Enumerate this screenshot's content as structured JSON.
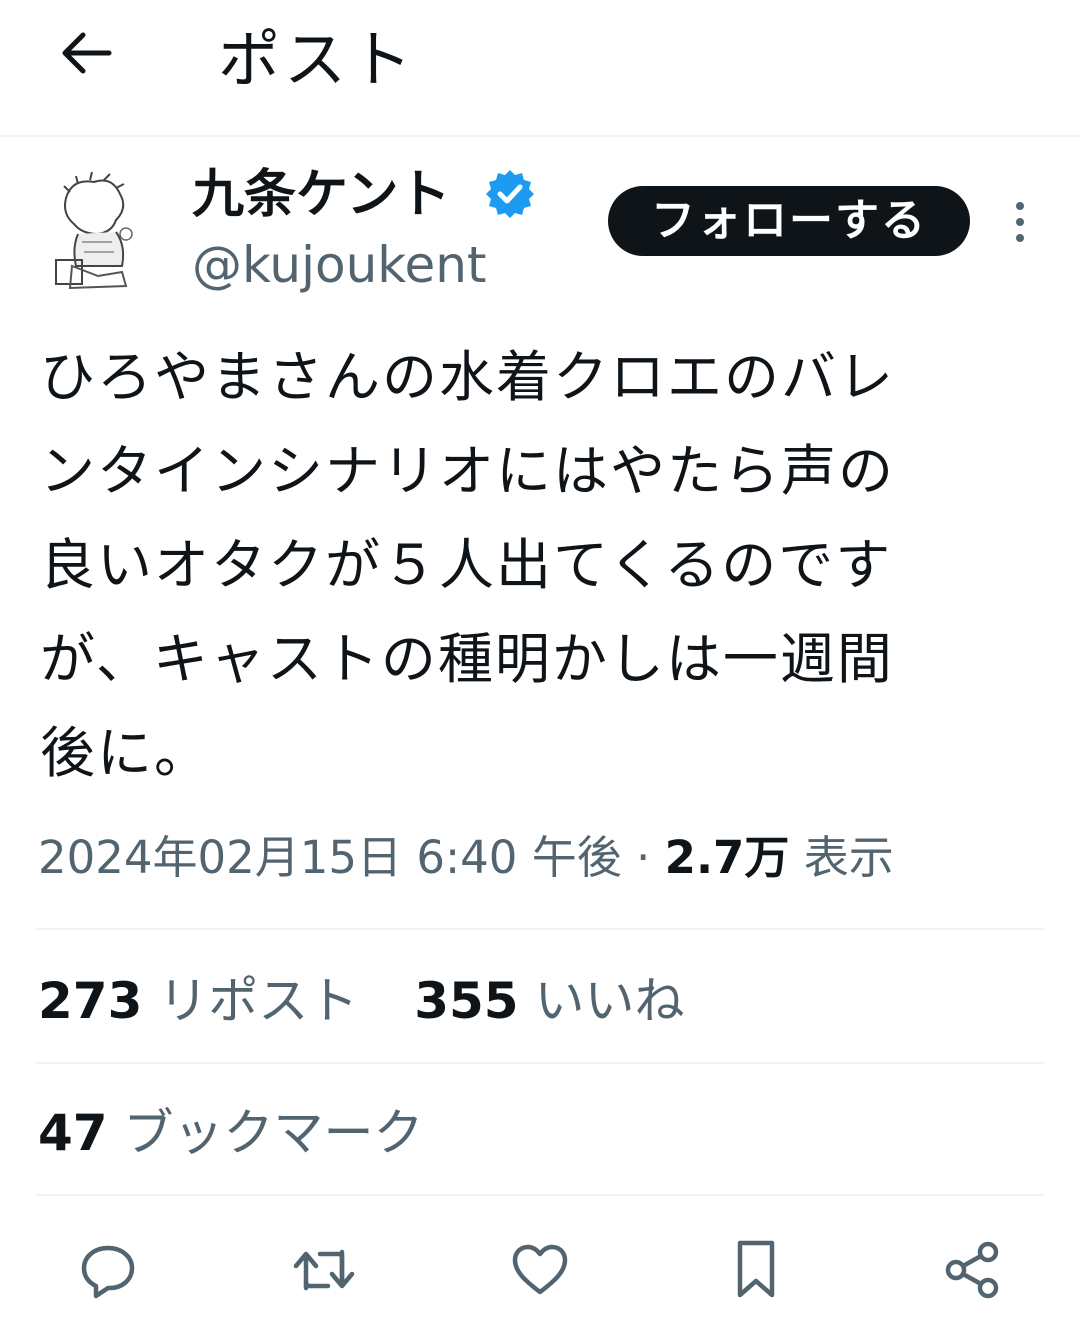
{
  "header": {
    "title": "ポスト",
    "back_icon": "arrow-left-icon"
  },
  "author": {
    "name": "九条ケント",
    "handle": "@kujoukent",
    "verified": true,
    "verified_color": "#1d9bf0"
  },
  "follow_label": "フォローする",
  "more_icon": "more-vertical-icon",
  "tweet": {
    "text": "ひろやまさんの水着クロエのバレ\nンタインシナリオにはやたら声の\n良いオタクが５人出てくるのです\nが、キャストの種明かしは一週間\n後に。"
  },
  "meta": {
    "timestamp": "2024年02月15日 6:40 午後",
    "separator": "·",
    "views_count": "2.7万",
    "views_label": "表示"
  },
  "stats": {
    "reposts_count": "273",
    "reposts_label": "リポスト",
    "likes_count": "355",
    "likes_label": "いいね",
    "bookmarks_count": "47",
    "bookmarks_label": "ブックマーク"
  },
  "actions": [
    "reply-icon",
    "repost-icon",
    "like-icon",
    "bookmark-icon",
    "share-icon"
  ],
  "colors": {
    "text": "#0f1419",
    "secondary": "#536471",
    "divider": "#eff3f4",
    "follow_bg": "#0f1419"
  }
}
